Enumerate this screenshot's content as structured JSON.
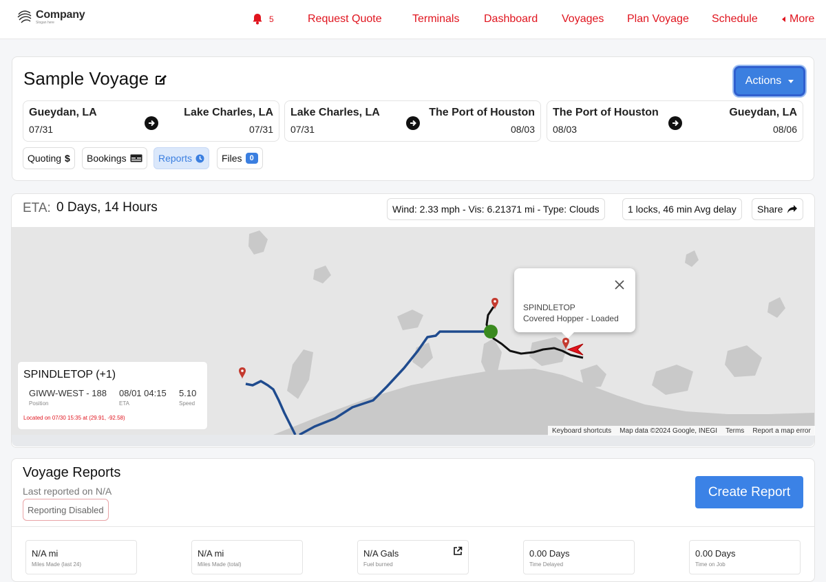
{
  "navbar": {
    "brand": "Company",
    "slogan": "Slogan here",
    "notification_count": "5",
    "items": [
      "Request Quote",
      "Terminals",
      "Dashboard",
      "Voyages",
      "Plan Voyage",
      "Schedule"
    ],
    "more_label": "More"
  },
  "voyage": {
    "title": "Sample Voyage",
    "actions_label": "Actions",
    "legs": [
      {
        "from": "Gueydan, LA",
        "to": "Lake Charles, LA",
        "from_date": "07/31",
        "to_date": "07/31"
      },
      {
        "from": "Lake Charles, LA",
        "to": "The Port of Houston",
        "from_date": "07/31",
        "to_date": "08/03"
      },
      {
        "from": "The Port of Houston",
        "to": "Gueydan, LA",
        "from_date": "08/03",
        "to_date": "08/06"
      }
    ],
    "tabs": {
      "quoting": "Quoting",
      "bookings": "Bookings",
      "reports": "Reports",
      "files": "Files",
      "files_count": "0"
    }
  },
  "eta": {
    "label": "ETA:",
    "value": "0 Days, 14 Hours",
    "weather": "Wind: 2.33 mph - Vis: 6.21371 mi - Type: Clouds",
    "locks": "1 locks, 46 min Avg delay",
    "share_label": "Share"
  },
  "map": {
    "popup": {
      "vessel": "SPINDLETOP",
      "cargo": "Covered Hopper - Loaded"
    },
    "attribution": [
      "Keyboard shortcuts",
      "Map data ©2024 Google, INEGI",
      "Terms",
      "Report a map error"
    ],
    "colors": {
      "route": "#1f4b8e",
      "track": "#111111",
      "vessel_dot": "#3a8a1f",
      "marker": "#e0141e"
    }
  },
  "vessel_card": {
    "name": "SPINDLETOP (+1)",
    "position": "GIWW-WEST - 188",
    "position_label": "Position",
    "eta": "08/01 04:15",
    "eta_label": "ETA",
    "speed": "5.10",
    "speed_label": "Speed",
    "located": "Located on 07/30 15:35 at (29.91, -92.58)"
  },
  "reports": {
    "title": "Voyage Reports",
    "last_reported": "Last reported on N/A",
    "status_badge": "Reporting Disabled",
    "create_label": "Create Report",
    "stats": [
      {
        "value": "N/A mi",
        "label": "Miles Made (last 24)"
      },
      {
        "value": "N/A mi",
        "label": "Miles Made (total)"
      },
      {
        "value": "N/A Gals",
        "label": "Fuel burned"
      },
      {
        "value": "0.00 Days",
        "label": "Time Delayed"
      },
      {
        "value": "0.00 Days",
        "label": "Time on Job"
      }
    ]
  },
  "colors": {
    "accent": "#3b7fe0",
    "nav_red": "#e0141e"
  }
}
